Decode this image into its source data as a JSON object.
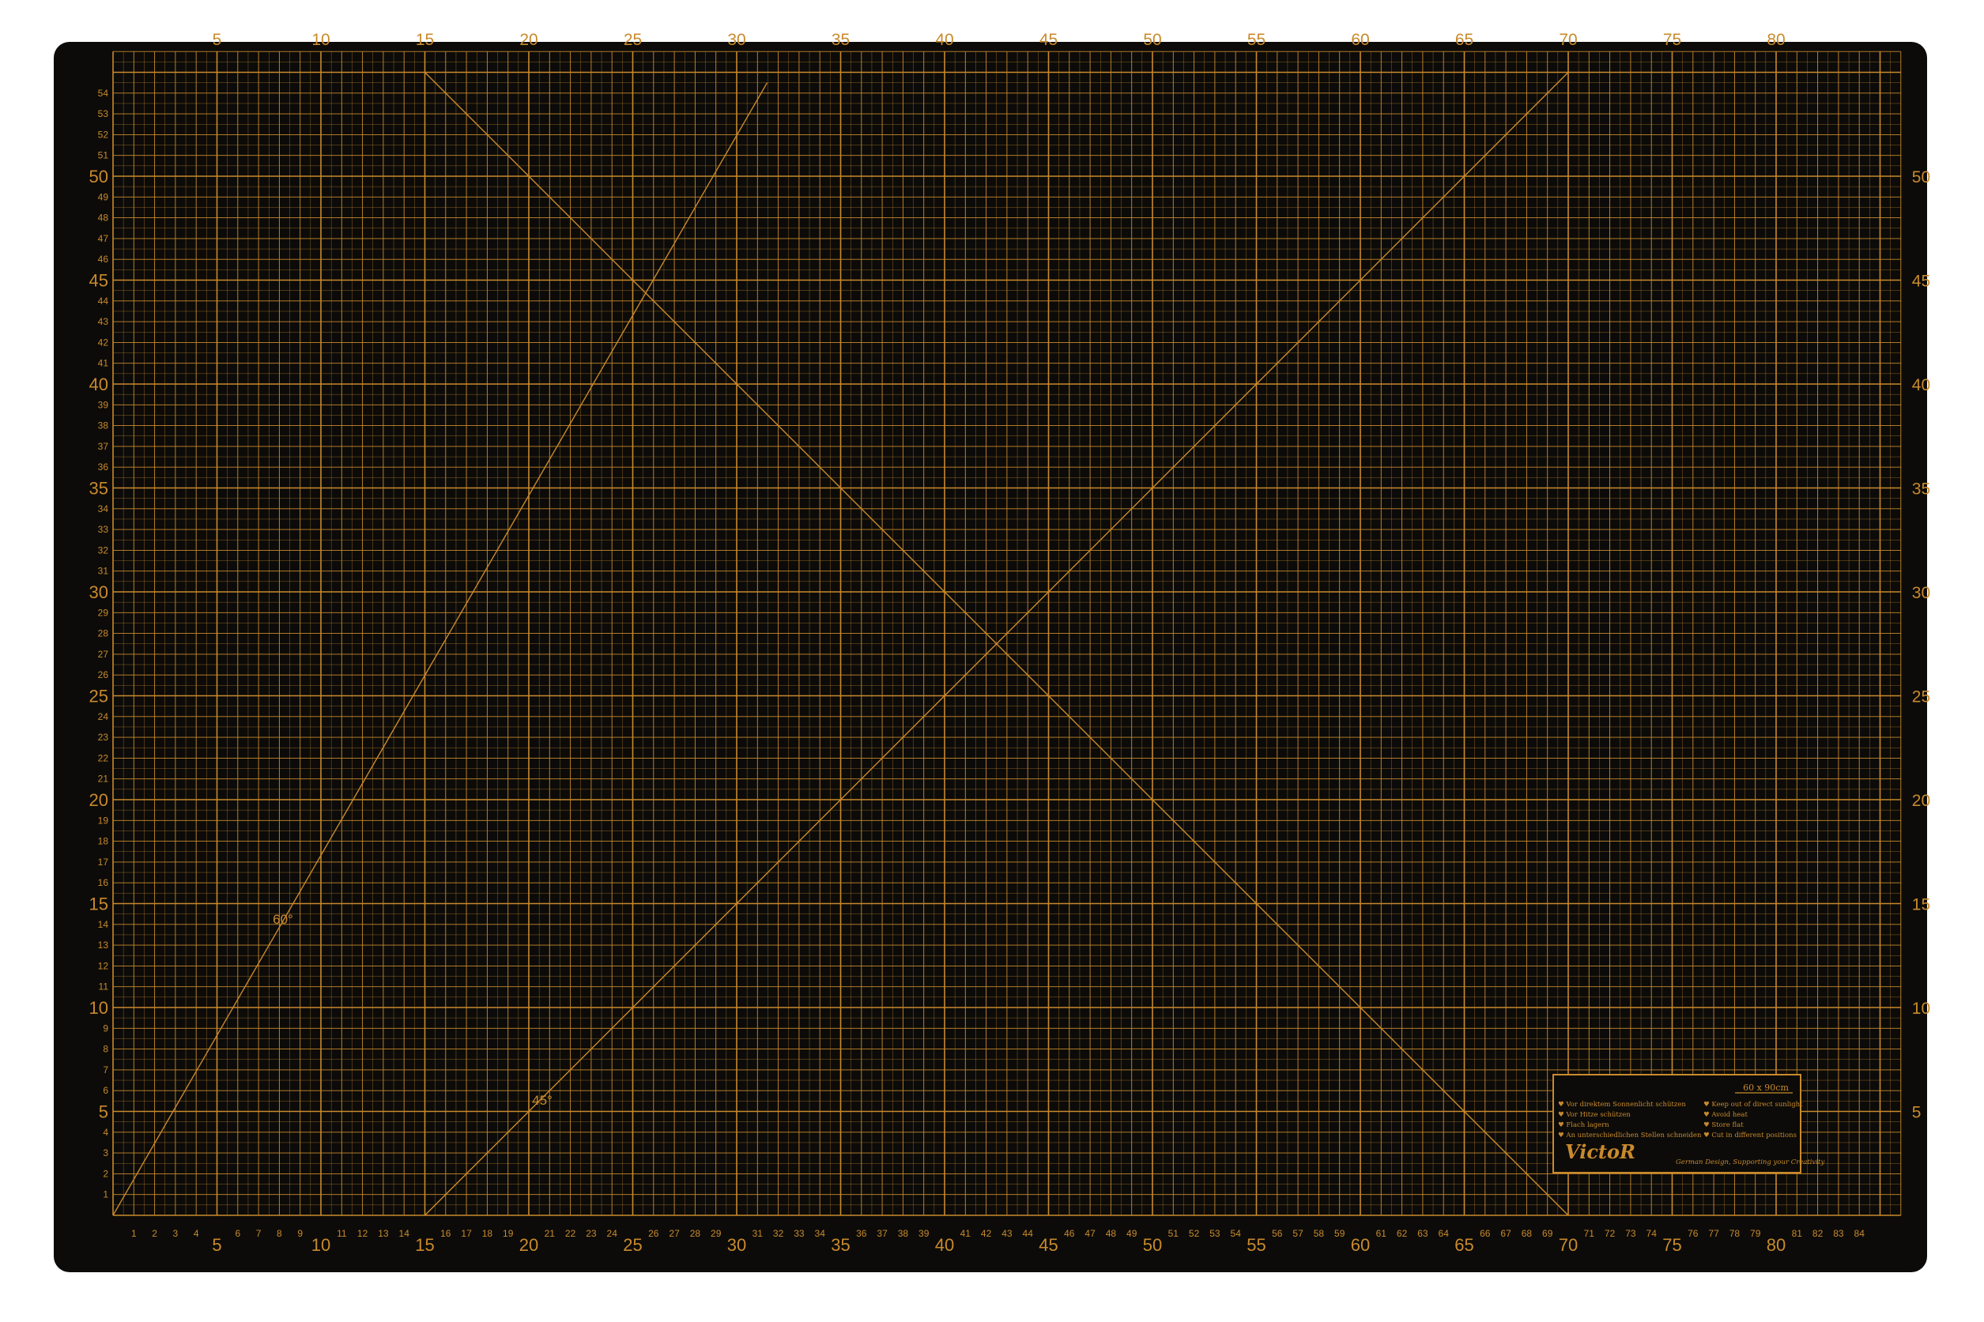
{
  "mat": {
    "size_label": "60 x 90cm",
    "colors": {
      "background": "#0c0b09",
      "grid_line": "#c98a2c",
      "text": "#c98a2c",
      "page": "#ffffff"
    },
    "top_ruler_labels": [
      "5",
      "10",
      "15",
      "20",
      "25",
      "30",
      "35",
      "40",
      "45",
      "50",
      "55",
      "60",
      "65",
      "70",
      "75",
      "80"
    ],
    "right_ruler_labels": [
      "5",
      "10",
      "15",
      "20",
      "25",
      "30",
      "35",
      "40",
      "45",
      "50"
    ],
    "left_ruler_max": 54,
    "bottom_ruler_max": 84,
    "angle_labels": {
      "sixty": "60°",
      "fortyfive": "45°"
    },
    "info_box": {
      "german": [
        "♥ Vor direktem Sonnenlicht schützen",
        "♥ Vor Hitze schützen",
        "♥ Flach lagern",
        "♥ An unterschiedlichen Stellen schneiden"
      ],
      "english": [
        "♥ Keep out of direct sunlight",
        "♥ Avoid heat",
        "♥ Store flat",
        "♥ Cut in different positions"
      ],
      "brand": "VictoR",
      "tagline": "German Design, Supporting your Creativity"
    }
  }
}
